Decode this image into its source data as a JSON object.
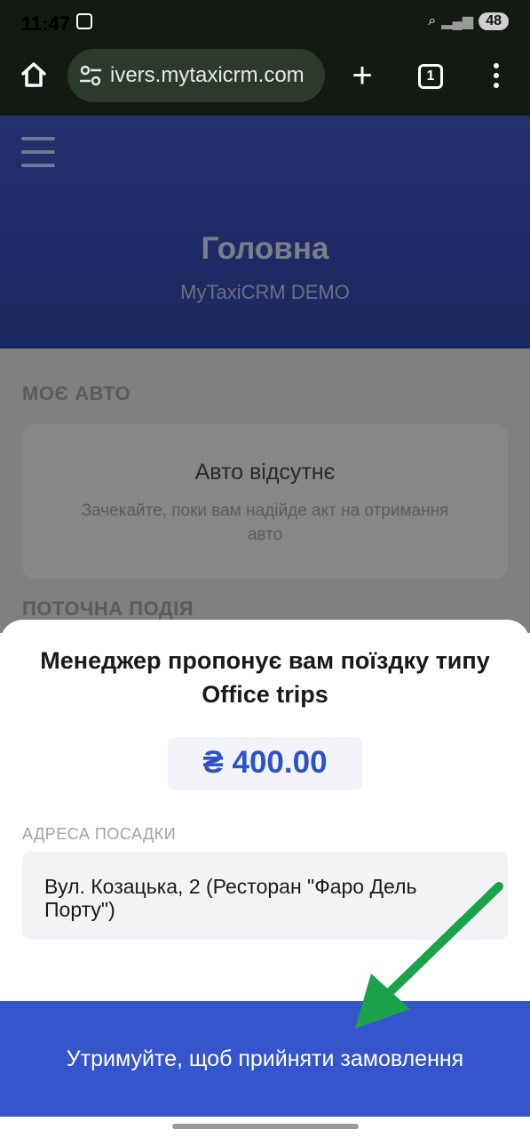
{
  "status_bar": {
    "time": "11:47",
    "battery": "48"
  },
  "browser": {
    "url": "ivers.mytaxicrm.com",
    "tab_count": "1"
  },
  "header": {
    "title": "Головна",
    "subtitle": "MyTaxiCRM DEMO"
  },
  "my_car": {
    "section_label": "МОЄ АВТО",
    "title": "Авто відсутнє",
    "text": "Зачекайте, поки вам надійде акт на отримання авто"
  },
  "current_event": {
    "section_label": "ПОТОЧНА ПОДІЯ"
  },
  "offer": {
    "title": "Менеджер пропонує вам поїздку типу Office trips",
    "price": "₴ 400.00",
    "address_label": "АДРЕСА ПОСАДКИ",
    "address": "Вул. Козацька, 2 (Ресторан \"Фаро Дель Порту\")",
    "accept_label": "Утримуйте, щоб прийняти замовлення"
  },
  "colors": {
    "accent": "#3555cc",
    "price": "#3152c4",
    "annotation_arrow": "#1aa34a"
  }
}
